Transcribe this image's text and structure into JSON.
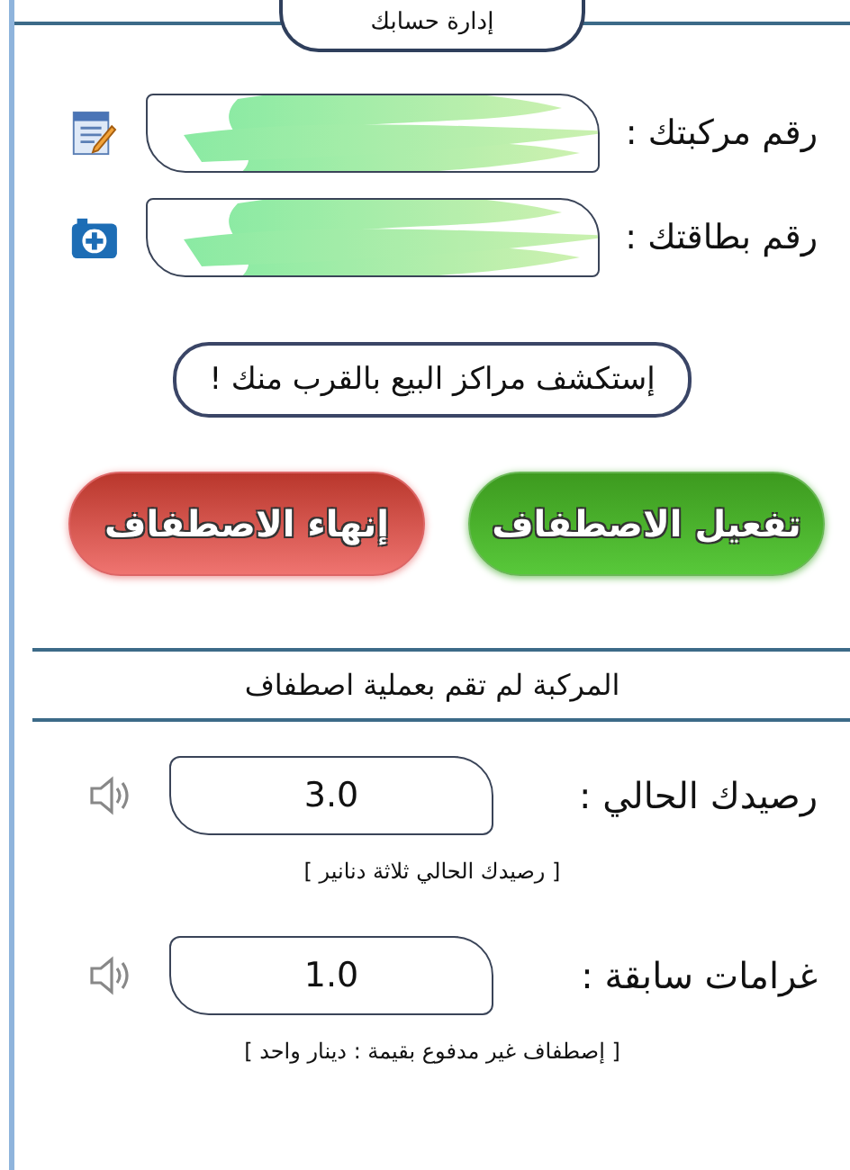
{
  "header": {
    "title": "إدارة حسابك"
  },
  "id_fields": [
    {
      "label": "رقم مركبتك :",
      "kind": "edit"
    },
    {
      "label": "رقم بطاقتك :",
      "kind": "camera"
    }
  ],
  "explore_button": "إستكشف مراكز البيع بالقرب منك !",
  "actions": [
    {
      "label": "تفعيل الاصطفاف",
      "kind": "start"
    },
    {
      "label": "إنهاء الاصطفاف",
      "kind": "end"
    }
  ],
  "status": "المركبة لم تقم بعملية اصطفاف",
  "balances": [
    {
      "label": "رصيدك الحالي :",
      "value": "3.0",
      "note": "[ رصيدك الحالي ثلاثة دنانير ]"
    },
    {
      "label": "غرامات سابقة :",
      "value": "1.0",
      "note": "[ إصطفاف غير مدفوع بقيمة : دينار واحد ]"
    }
  ]
}
